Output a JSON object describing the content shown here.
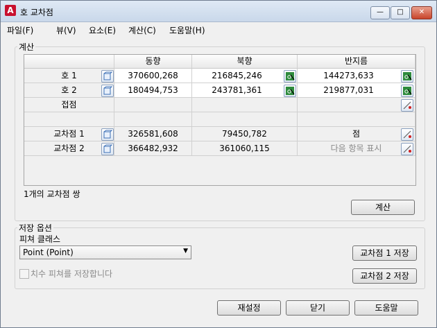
{
  "window": {
    "title": "호 교차점",
    "minimize": "—",
    "maximize": "□",
    "close": "✕"
  },
  "menu": [
    {
      "label": "파일(F)"
    },
    {
      "label": "뷰(V)"
    },
    {
      "label": "요소(E)"
    },
    {
      "label": "계산(C)"
    },
    {
      "label": "도움말(H)"
    }
  ],
  "calc": {
    "group_label": "계산",
    "headers": [
      "동향",
      "북향",
      "반지름"
    ],
    "rows": [
      {
        "label": "호 1",
        "east": "370600,268",
        "north": "216845,246",
        "radius": "144273,633"
      },
      {
        "label": "호 2",
        "east": "180494,753",
        "north": "243781,361",
        "radius": "219877,031"
      },
      {
        "label": "접점",
        "east": "",
        "north": "",
        "radius": ""
      },
      {
        "label": "교차점 1",
        "east": "326581,608",
        "north": "79450,782",
        "radius": "점"
      },
      {
        "label": "교차점 2",
        "east": "366482,932",
        "north": "361060,115",
        "radius": "다음 항목 표시"
      }
    ],
    "status": "1개의 교차점 쌍",
    "calculate_label": "계산"
  },
  "save": {
    "group_label": "저장 옵션",
    "feature_class_label": "피쳐 클래스",
    "feature_class_value": "Point (Point)",
    "dimension_label": "치수 피쳐를 저장합니다",
    "dimension_checked": false,
    "save1_label": "교차점 1 저장",
    "save2_label": "교차점 2 저장"
  },
  "footer": {
    "reset_label": "재설정",
    "close_label": "닫기",
    "help_label": "도움말"
  },
  "colors": {
    "accent": "#c8102e",
    "pick_green": "#2e8b3d",
    "pick_red": "#d02020"
  }
}
